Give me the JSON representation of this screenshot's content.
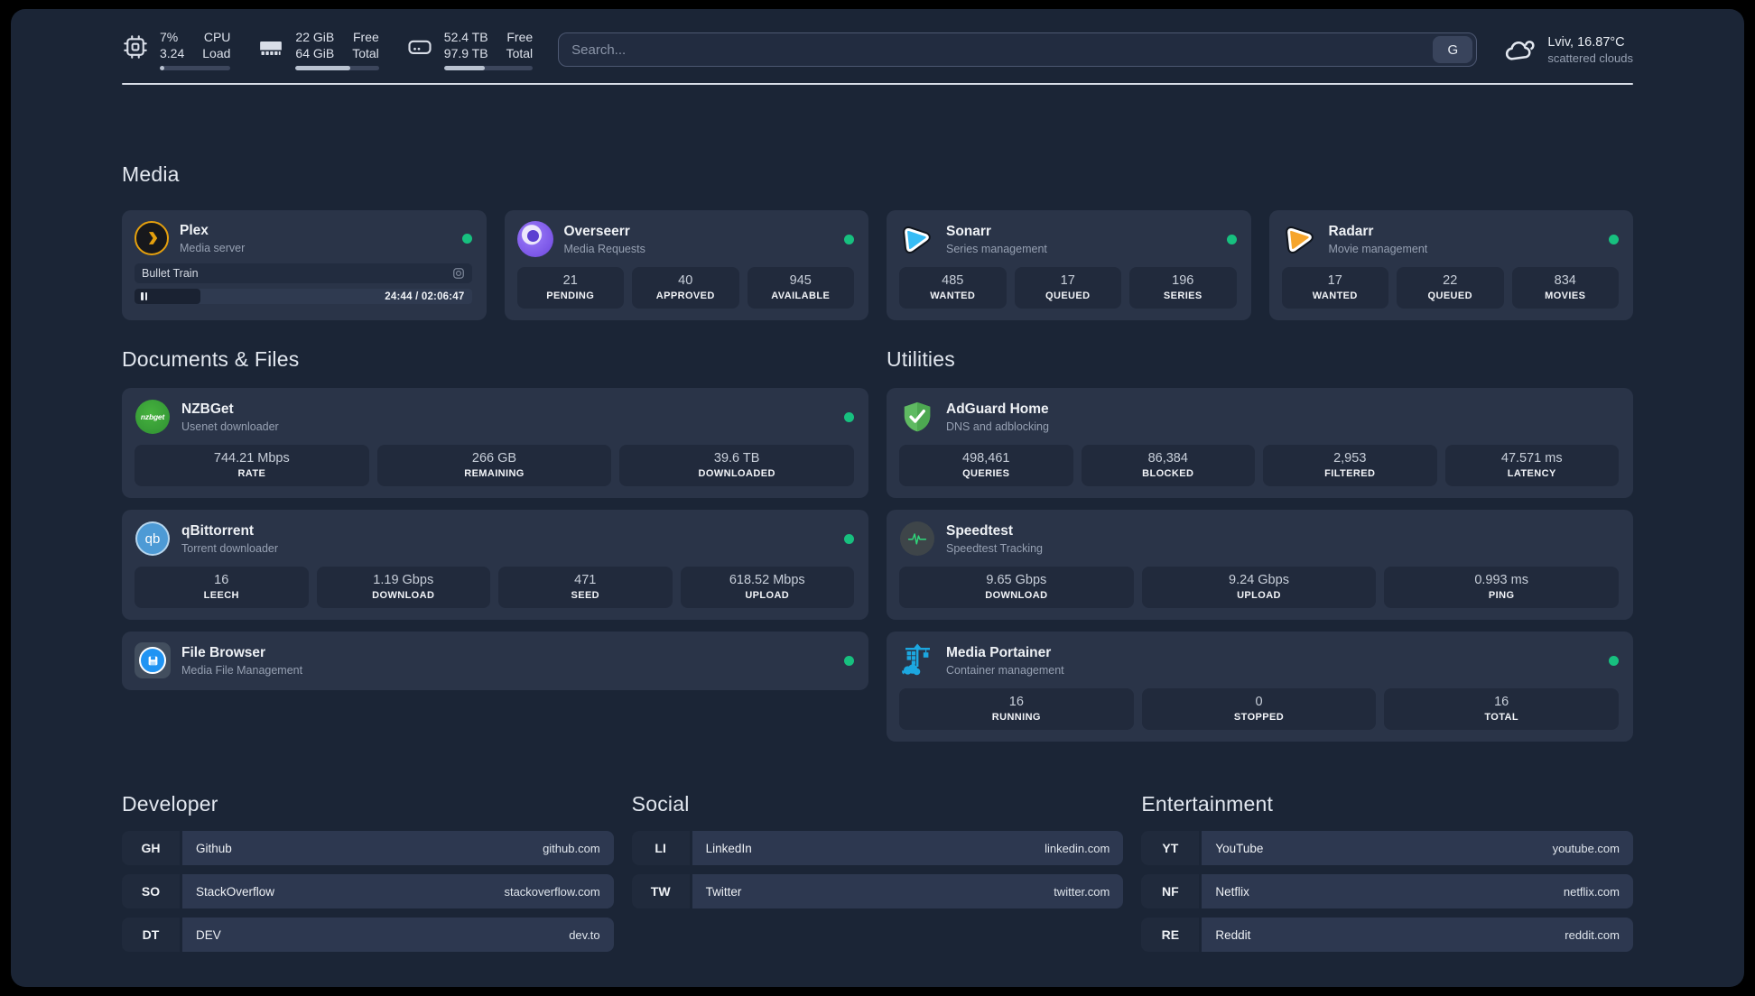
{
  "topbar": {
    "resources": [
      {
        "icon": "cpu-icon",
        "value_top": "7%",
        "value_bottom": "3.24",
        "label_top": "CPU",
        "label_bottom": "Load",
        "progress_pct": 7
      },
      {
        "icon": "memory-icon",
        "value_top": "22 GiB",
        "value_bottom": "64 GiB",
        "label_top": "Free",
        "label_bottom": "Total",
        "progress_pct": 66
      },
      {
        "icon": "disk-icon",
        "value_top": "52.4 TB",
        "value_bottom": "97.9 TB",
        "label_top": "Free",
        "label_bottom": "Total",
        "progress_pct": 46
      }
    ],
    "search": {
      "placeholder": "Search...",
      "engine_button": "G"
    },
    "weather": {
      "line1": "Lviv, 16.87°C",
      "line2": "scattered clouds"
    }
  },
  "media": {
    "title": "Media",
    "plex": {
      "name": "Plex",
      "desc": "Media server",
      "online": true,
      "now_playing": {
        "title": "Bullet Train",
        "time": "24:44 / 02:06:47",
        "progress_pct": 19.5
      }
    },
    "cards": [
      {
        "name": "Overseerr",
        "desc": "Media Requests",
        "online": true,
        "stats": [
          {
            "value": "21",
            "label": "PENDING"
          },
          {
            "value": "40",
            "label": "APPROVED"
          },
          {
            "value": "945",
            "label": "AVAILABLE"
          }
        ]
      },
      {
        "name": "Sonarr",
        "desc": "Series management",
        "online": true,
        "stats": [
          {
            "value": "485",
            "label": "WANTED"
          },
          {
            "value": "17",
            "label": "QUEUED"
          },
          {
            "value": "196",
            "label": "SERIES"
          }
        ]
      },
      {
        "name": "Radarr",
        "desc": "Movie management",
        "online": true,
        "stats": [
          {
            "value": "17",
            "label": "WANTED"
          },
          {
            "value": "22",
            "label": "QUEUED"
          },
          {
            "value": "834",
            "label": "MOVIES"
          }
        ]
      }
    ]
  },
  "documents": {
    "title": "Documents & Files",
    "cards": [
      {
        "name": "NZBGet",
        "desc": "Usenet downloader",
        "online": true,
        "stats": [
          {
            "value": "744.21 Mbps",
            "label": "RATE"
          },
          {
            "value": "266 GB",
            "label": "REMAINING"
          },
          {
            "value": "39.6 TB",
            "label": "DOWNLOADED"
          }
        ]
      },
      {
        "name": "qBittorrent",
        "desc": "Torrent downloader",
        "online": true,
        "stats": [
          {
            "value": "16",
            "label": "LEECH"
          },
          {
            "value": "1.19 Gbps",
            "label": "DOWNLOAD"
          },
          {
            "value": "471",
            "label": "SEED"
          },
          {
            "value": "618.52 Mbps",
            "label": "UPLOAD"
          }
        ]
      },
      {
        "name": "File Browser",
        "desc": "Media File Management",
        "online": true,
        "stats": []
      }
    ]
  },
  "utilities": {
    "title": "Utilities",
    "cards": [
      {
        "name": "AdGuard Home",
        "desc": "DNS and adblocking",
        "online": false,
        "stats": [
          {
            "value": "498,461",
            "label": "QUERIES"
          },
          {
            "value": "86,384",
            "label": "BLOCKED"
          },
          {
            "value": "2,953",
            "label": "FILTERED"
          },
          {
            "value": "47.571 ms",
            "label": "LATENCY"
          }
        ]
      },
      {
        "name": "Speedtest",
        "desc": "Speedtest Tracking",
        "online": false,
        "stats": [
          {
            "value": "9.65 Gbps",
            "label": "DOWNLOAD"
          },
          {
            "value": "9.24 Gbps",
            "label": "UPLOAD"
          },
          {
            "value": "0.993 ms",
            "label": "PING"
          }
        ]
      },
      {
        "name": "Media Portainer",
        "desc": "Container management",
        "online": true,
        "stats": [
          {
            "value": "16",
            "label": "RUNNING"
          },
          {
            "value": "0",
            "label": "STOPPED"
          },
          {
            "value": "16",
            "label": "TOTAL"
          }
        ]
      }
    ]
  },
  "links": {
    "developer": {
      "title": "Developer",
      "items": [
        {
          "tag": "GH",
          "name": "Github",
          "url": "github.com"
        },
        {
          "tag": "SO",
          "name": "StackOverflow",
          "url": "stackoverflow.com"
        },
        {
          "tag": "DT",
          "name": "DEV",
          "url": "dev.to"
        }
      ]
    },
    "social": {
      "title": "Social",
      "items": [
        {
          "tag": "LI",
          "name": "LinkedIn",
          "url": "linkedin.com"
        },
        {
          "tag": "TW",
          "name": "Twitter",
          "url": "twitter.com"
        }
      ]
    },
    "entertainment": {
      "title": "Entertainment",
      "items": [
        {
          "tag": "YT",
          "name": "YouTube",
          "url": "youtube.com"
        },
        {
          "tag": "NF",
          "name": "Netflix",
          "url": "netflix.com"
        },
        {
          "tag": "RE",
          "name": "Reddit",
          "url": "reddit.com"
        }
      ]
    }
  },
  "colors": {
    "status_online": "#17c07f",
    "plex_accent": "#e5a00d",
    "overseerr_accent": "#7a55e6",
    "sonarr_accent": "#36bcf5",
    "radarr_accent": "#f6a52c",
    "nzbget_accent": "#3aa93f",
    "qbittorrent_accent": "#4d9ad5",
    "filebrowser_accent": "#2094f3",
    "adguard_accent": "#4da851",
    "speedtest_accent": "#2fd77a",
    "portainer_accent": "#1ca7e0"
  }
}
